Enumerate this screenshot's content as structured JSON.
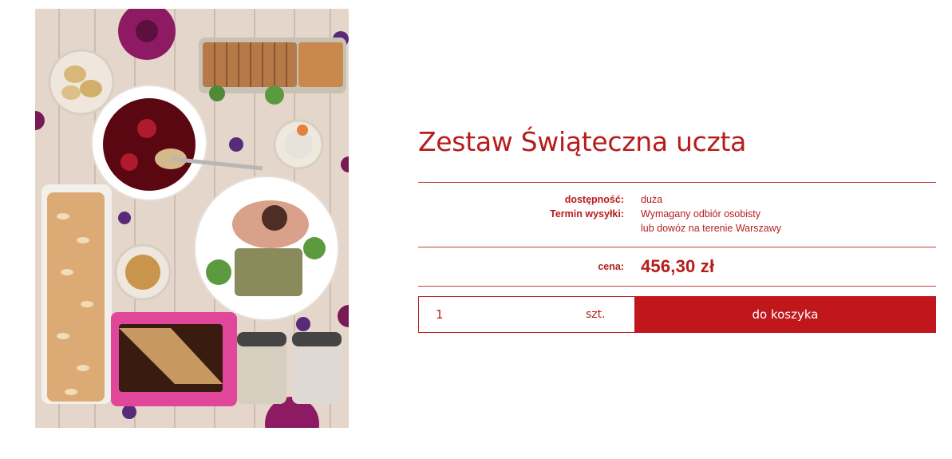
{
  "product": {
    "title": "Zestaw Świąteczna uczta",
    "availability_label": "dostępność:",
    "availability_value": "duża",
    "shipping_label": "Termin wysyłki:",
    "shipping_value": "Wymagany odbiór osobisty\nlub dowóz na terenie Warszawy",
    "price_label": "cena:",
    "price_value": "456,30 zł"
  },
  "cart": {
    "quantity": "1",
    "unit": "szt.",
    "add_label": "do koszyka"
  },
  "colors": {
    "accent": "#b71c1c",
    "button": "#c0171c",
    "text_on_button": "#ffffff"
  }
}
